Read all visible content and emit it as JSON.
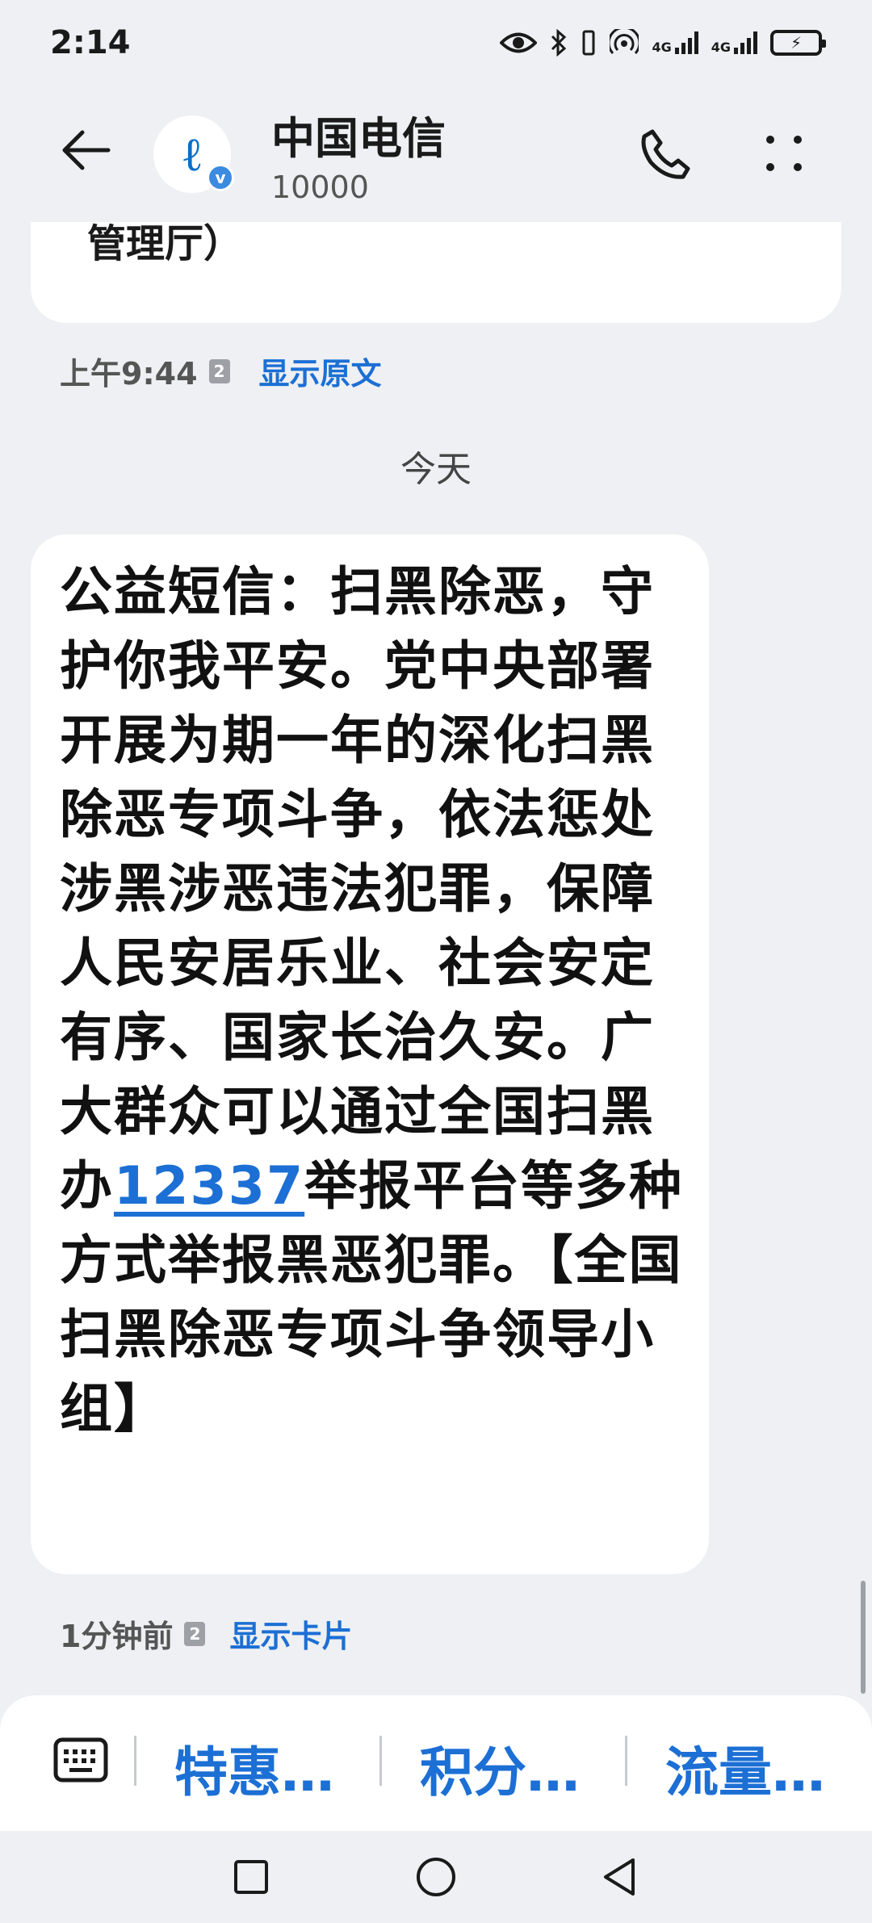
{
  "status_bar": {
    "time": "2:14",
    "signal_1_label": "4G",
    "signal_2_label": "4G"
  },
  "header": {
    "contact_name": "中国电信",
    "contact_number": "10000",
    "avatar_letter": "ℓ",
    "verified_mark": "v"
  },
  "previous_message": {
    "text_tail": "管理厅）",
    "time": "上午9:44",
    "sim": "2",
    "action": "显示原文"
  },
  "day_divider": "今天",
  "message": {
    "text_before_link": "公益短信：扫黑除恶，守护你我平安。党中央部署开展为期一年的深化扫黑除恶专项斗争，依法惩处涉黑涉恶违法犯罪，保障人民安居乐业、社会安定有序、国家长治久安。广大群众可以通过全国扫黑办",
    "link_number": "12337",
    "text_after_link": "举报平台等多种方式举报黑恶犯罪。【全国扫黑除恶专项斗争领导小组】",
    "time": "1分钟前",
    "sim": "2",
    "action": "显示卡片"
  },
  "quick_replies": [
    "特惠…",
    "积分…",
    "流量…"
  ],
  "colors": {
    "accent": "#1c6fd4",
    "background": "#eef0f3",
    "bubble": "#ffffff"
  },
  "icons": [
    "back-arrow-icon",
    "phone-icon",
    "more-vert-icon",
    "keyboard-icon",
    "recent-apps-icon",
    "home-icon",
    "back-nav-icon",
    "eye-icon",
    "bluetooth-icon",
    "vibrate-icon",
    "hotspot-icon",
    "battery-icon"
  ]
}
